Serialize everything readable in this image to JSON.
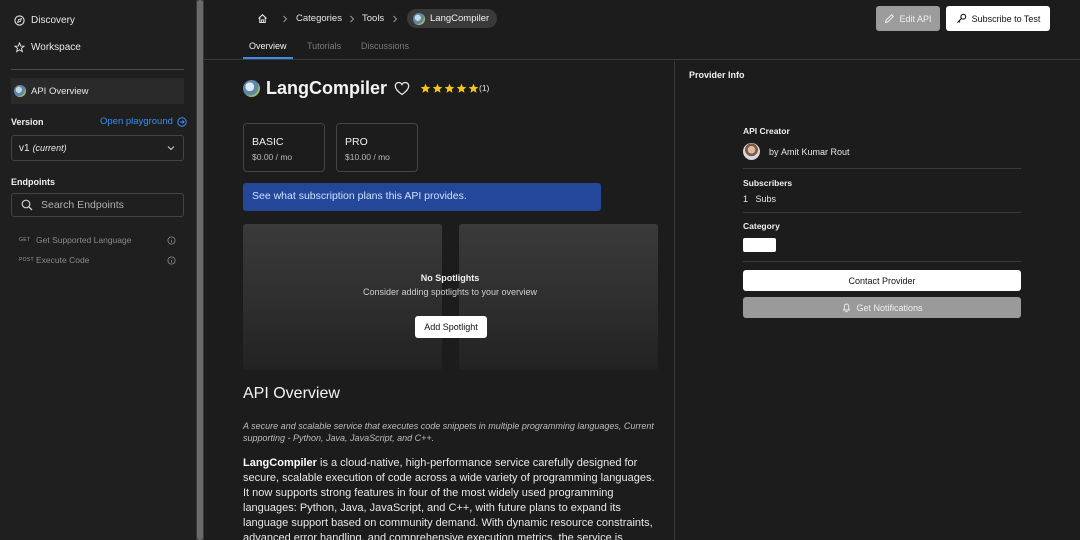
{
  "sidebar": {
    "nav": [
      {
        "label": "Discovery",
        "icon": "compass-icon"
      },
      {
        "label": "Workspace",
        "icon": "star-icon"
      }
    ],
    "api_overview_label": "API Overview",
    "version_label": "Version",
    "open_playground": "Open playground",
    "version_value": "v1",
    "version_note": "(current)",
    "endpoints_label": "Endpoints",
    "search_placeholder": "Search Endpoints",
    "endpoints": [
      {
        "method": "GET",
        "name": "Get Supported Language"
      },
      {
        "method": "POST",
        "name": "Execute Code"
      }
    ]
  },
  "header": {
    "breadcrumbs": [
      "Categories",
      "Tools"
    ],
    "current": "LangCompiler",
    "tabs": [
      "Overview",
      "Tutorials",
      "Discussions"
    ],
    "edit_label": "Edit API",
    "subscribe_label": "Subscribe to Test"
  },
  "api": {
    "name": "LangCompiler",
    "rating_count": "(1)",
    "rating": 5,
    "plans": [
      {
        "name": "BASIC",
        "price": "$0.00 / mo"
      },
      {
        "name": "PRO",
        "price": "$10.00 / mo"
      }
    ],
    "banner": "See what subscription plans this API provides.",
    "spotlight_title": "No Spotlights",
    "spotlight_sub": "Consider adding spotlights to your overview",
    "add_spotlight": "Add Spotlight",
    "overview_heading": "API Overview",
    "italic_desc": "A secure and scalable service that executes code snippets in multiple programming languages, Current supporting - Python, Java, JavaScript, and C++.",
    "body_bold": "LangCompiler",
    "body_rest": " is a cloud-native, high-performance service carefully designed for secure, scalable execution of code across a wide variety of programming languages. It now supports strong features in four of the most widely used programming languages: Python, Java, JavaScript, and C++, with future plans to expand its language support based on community demand. With dynamic resource constraints, advanced error handling, and comprehensive execution metrics, the service is particularly well-suited"
  },
  "provider": {
    "title": "Provider Info",
    "creator_label": "API Creator",
    "creator_by": "by",
    "creator_name": "Amit Kumar Rout",
    "subscribers_label": "Subscribers",
    "subs_count": "1",
    "subs_unit": "Subs",
    "category_label": "Category",
    "contact": "Contact Provider",
    "notify": "Get Notifications"
  },
  "colors": {
    "accent": "#3b8df0",
    "banner": "#24479a",
    "star": "#f5c518"
  }
}
